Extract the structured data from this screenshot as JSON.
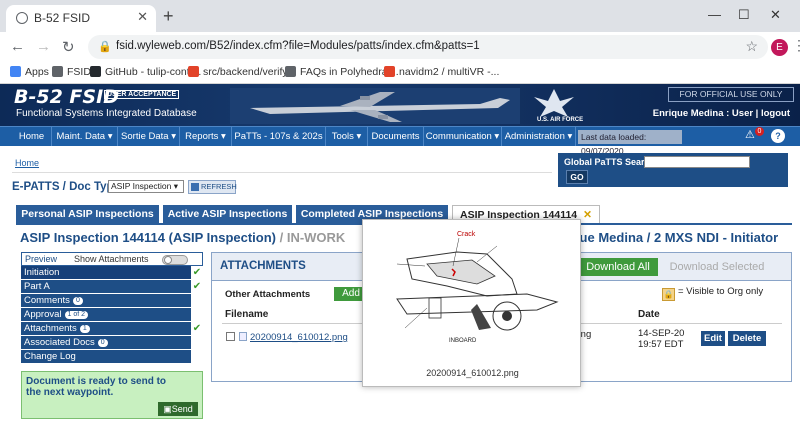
{
  "browser": {
    "tab_title": "B-52 FSID",
    "url": "fsid.wyleweb.com/B52/index.cfm?file=Modules/patts/index.cfm&patts=1",
    "profile_initial": "E",
    "bookmarks": [
      {
        "label": "Apps",
        "color": "#4285f4"
      },
      {
        "label": "FSID",
        "color": "#5f6368"
      },
      {
        "label": "GitHub - tulip-contr...",
        "color": "#24292e"
      },
      {
        "label": "src/backend/verify...",
        "color": "#e24329"
      },
      {
        "label": "FAQs in Polyhedral...",
        "color": "#5f6368"
      },
      {
        "label": "navidm2 / multiVR -...",
        "color": "#e24329"
      }
    ]
  },
  "app": {
    "brand": "B-52 FSID",
    "badge": "USER ACCEPTANCE",
    "subtitle": "Functional Systems Integrated Database",
    "af_label": "U.S. AIR FORCE",
    "official": "FOR OFFICIAL USE ONLY",
    "user_line": "Enrique Medina : User | logout",
    "nav": [
      {
        "label": "Home"
      },
      {
        "label": "Maint. Data ▾"
      },
      {
        "label": "Sortie Data ▾"
      },
      {
        "label": "Reports ▾"
      },
      {
        "label": "PaTTs - 107s & 202s ▾"
      },
      {
        "label": "Tools ▾"
      },
      {
        "label": "Documents"
      },
      {
        "label": "Communication ▾"
      },
      {
        "label": "Administration ▾"
      }
    ],
    "last_loaded": "Last data loaded: 09/07/2020",
    "notif_count": "0",
    "help": "?"
  },
  "page": {
    "crumb_home": "Home",
    "global_search_label": "Global PaTTS Search",
    "go": "GO",
    "epatts_label": "E-PATTS / Doc Type",
    "doctype_value": "ASIP Inspection",
    "refresh": "REFRESH",
    "tabs": [
      {
        "label": "Personal ASIP Inspections"
      },
      {
        "label": "Active ASIP Inspections"
      },
      {
        "label": "Completed ASIP Inspections"
      },
      {
        "label": "ASIP Inspection 144114"
      }
    ],
    "inspection_title": "ASIP Inspection 144114 (ASIP Inspection)",
    "inspection_status": " / IN-WORK",
    "inspection_right": "ique Medina / 2 MXS NDI - Initiator"
  },
  "sidebar": {
    "preview": "Preview",
    "show_attachments": "Show Attachments",
    "items": [
      {
        "label": "Initiation",
        "count": "",
        "check": "✔"
      },
      {
        "label": "Part A",
        "count": "",
        "check": "✔"
      },
      {
        "label": "Comments",
        "count": "0",
        "check": ""
      },
      {
        "label": "Approval",
        "count": "1 of 2",
        "check": ""
      },
      {
        "label": "Attachments",
        "count": "1",
        "check": "✔"
      },
      {
        "label": "Associated Docs",
        "count": "0",
        "check": ""
      },
      {
        "label": "Change Log",
        "count": "",
        "check": ""
      }
    ],
    "ready_text_1": "Document is ready to send to",
    "ready_text_2": "the next waypoint.",
    "send": "Send"
  },
  "attachments": {
    "title": "ATTACHMENTS",
    "download_all": "Download All",
    "download_selected": "Download Selected",
    "other_label": "Other Attachments",
    "add": "Add",
    "visible_note": "= Visible to Org only",
    "col_filename": "Filename",
    "col_date": "Date",
    "rows": [
      {
        "filename": "20200914_610012.png",
        "desc_fragment": "being",
        "date_1": "14-SEP-20",
        "date_2": "19:57 EDT",
        "edit": "Edit",
        "delete": "Delete"
      }
    ]
  },
  "preview_popup": {
    "caption": "20200914_610012.png",
    "crack": "Crack",
    "inboard": "INBOARD"
  }
}
